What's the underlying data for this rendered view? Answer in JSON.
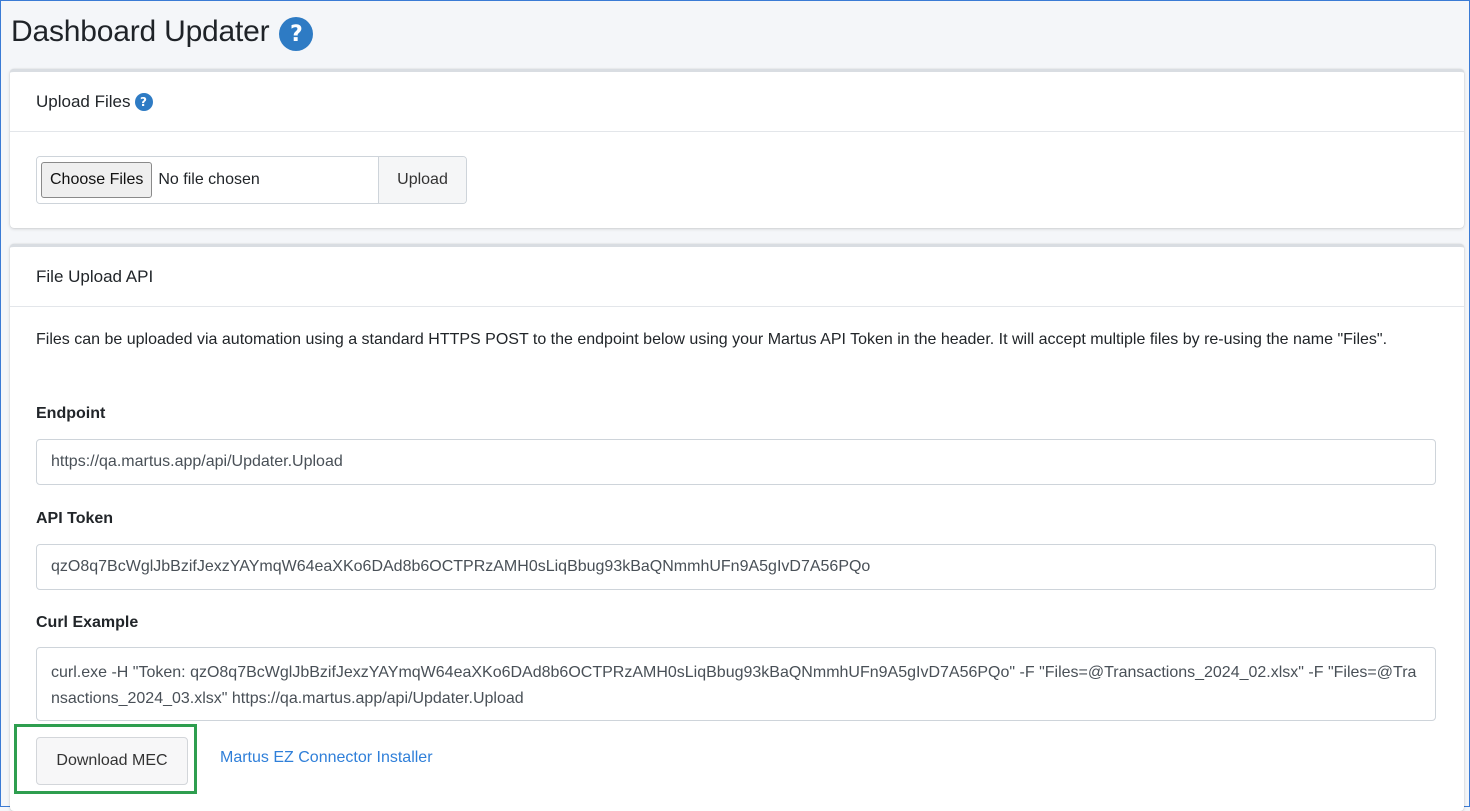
{
  "page": {
    "title": "Dashboard Updater",
    "help_glyph": "?"
  },
  "upload_card": {
    "title": "Upload Files",
    "help_glyph": "?",
    "choose_button": "Choose Files",
    "file_status": "No file chosen",
    "upload_button": "Upload"
  },
  "api_card": {
    "title": "File Upload API",
    "description": "Files can be uploaded via automation using a standard HTTPS POST to the endpoint below using your Martus API Token in the header. It will accept multiple files by re-using the name \"Files\".",
    "endpoint_label": "Endpoint",
    "endpoint_value": "https://qa.martus.app/api/Updater.Upload",
    "token_label": "API Token",
    "token_value": "qzO8q7BcWglJbBzifJexzYAYmqW64eaXKo6DAd8b6OCTPRzAMH0sLiqBbug93kBaQNmmhUFn9A5gIvD7A56PQo",
    "curl_label": "Curl Example",
    "curl_value": "curl.exe -H \"Token: qzO8q7BcWglJbBzifJexzYAYmqW64eaXKo6DAd8b6OCTPRzAMH0sLiqBbug93kBaQNmmhUFn9A5gIvD7A56PQo\" -F \"Files=@Transactions_2024_02.xlsx\" -F \"Files=@Transactions_2024_03.xlsx\" https://qa.martus.app/api/Updater.Upload"
  },
  "actions": {
    "download_button": "Download MEC",
    "installer_link": "Martus EZ Connector Installer"
  },
  "colors": {
    "accent_blue": "#2e7bc4",
    "link_blue": "#2f7fd9",
    "highlight_green": "#2e9e4f"
  },
  "icons": {
    "help": "question-circle-icon"
  }
}
